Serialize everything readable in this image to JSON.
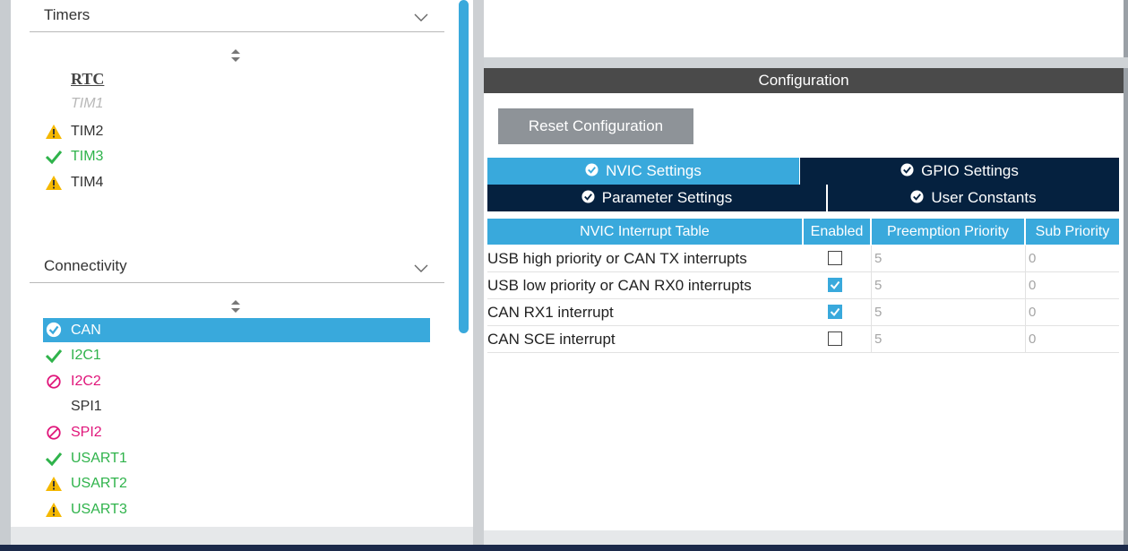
{
  "colors": {
    "accent": "#39a9dc",
    "dark_tab": "#05213f",
    "ok_green": "#2fb34b",
    "warn_yellow": "#f5b800",
    "disabled_pink": "#e0157a",
    "config_bar": "#4a4a4a"
  },
  "timers": {
    "header": "Timers",
    "items": [
      {
        "label": "RTC",
        "status": "none"
      },
      {
        "label": "TIM1",
        "status": "unavailable"
      },
      {
        "label": "TIM2",
        "status": "warning",
        "icon": "warning-icon"
      },
      {
        "label": "TIM3",
        "status": "ok",
        "icon": "check-icon"
      },
      {
        "label": "TIM4",
        "status": "warning",
        "icon": "warning-icon"
      }
    ]
  },
  "connectivity": {
    "header": "Connectivity",
    "items": [
      {
        "label": "CAN",
        "status": "selected-ok",
        "icon": "check-circle-icon"
      },
      {
        "label": "I2C1",
        "status": "ok",
        "icon": "check-icon"
      },
      {
        "label": "I2C2",
        "status": "disabled",
        "icon": "blocked-icon"
      },
      {
        "label": "SPI1",
        "status": "none"
      },
      {
        "label": "SPI2",
        "status": "disabled",
        "icon": "blocked-icon"
      },
      {
        "label": "USART1",
        "status": "ok",
        "icon": "check-icon"
      },
      {
        "label": "USART2",
        "status": "warning",
        "icon": "warning-icon"
      },
      {
        "label": "USART3",
        "status": "warning",
        "icon": "warning-icon"
      }
    ]
  },
  "config": {
    "title": "Configuration",
    "reset_label": "Reset Configuration",
    "tabs": [
      {
        "label": "NVIC Settings",
        "active": true
      },
      {
        "label": "GPIO Settings",
        "active": false
      },
      {
        "label": "Parameter Settings",
        "active": false
      },
      {
        "label": "User Constants",
        "active": false
      }
    ]
  },
  "nvic_table": {
    "headers": [
      "NVIC Interrupt Table",
      "Enabled",
      "Preemption Priority",
      "Sub Priority"
    ],
    "rows": [
      {
        "name": "USB high priority or CAN TX interrupts",
        "enabled": false,
        "preemption": "5",
        "sub": "0"
      },
      {
        "name": "USB low priority or CAN RX0 interrupts",
        "enabled": true,
        "preemption": "5",
        "sub": "0"
      },
      {
        "name": "CAN RX1 interrupt",
        "enabled": true,
        "preemption": "5",
        "sub": "0"
      },
      {
        "name": "CAN SCE interrupt",
        "enabled": false,
        "preemption": "5",
        "sub": "0"
      }
    ]
  }
}
